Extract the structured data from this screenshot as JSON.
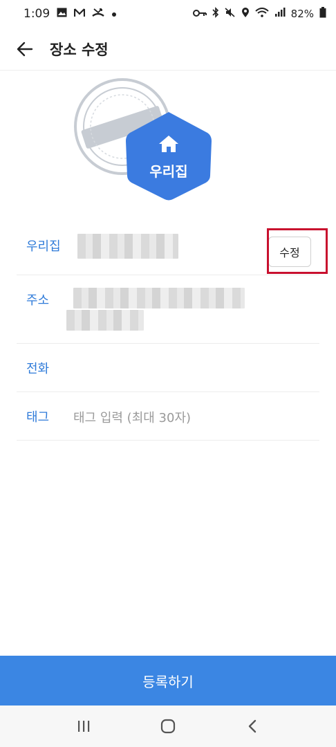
{
  "status_bar": {
    "time": "1:09",
    "battery": "82%",
    "left_icons": [
      "gallery-icon",
      "mail-icon",
      "missed-call-icon",
      "dot-icon"
    ],
    "right_icons": [
      "key-icon",
      "bluetooth-icon",
      "mute-icon",
      "location-icon",
      "wifi-icon",
      "signal-icon",
      "battery-icon"
    ]
  },
  "app_bar": {
    "title": "장소 수정"
  },
  "hero": {
    "badge_label": "우리집",
    "accent_color": "#3b7be0"
  },
  "form": {
    "name_label": "우리집",
    "edit_button": "수정",
    "address_label": "주소",
    "phone_label": "전화",
    "tag_label": "태그",
    "tag_placeholder": "태그 입력 (최대 30자)"
  },
  "submit": {
    "label": "등록하기",
    "color": "#3b86e3"
  },
  "highlight_color": "#c8102e"
}
